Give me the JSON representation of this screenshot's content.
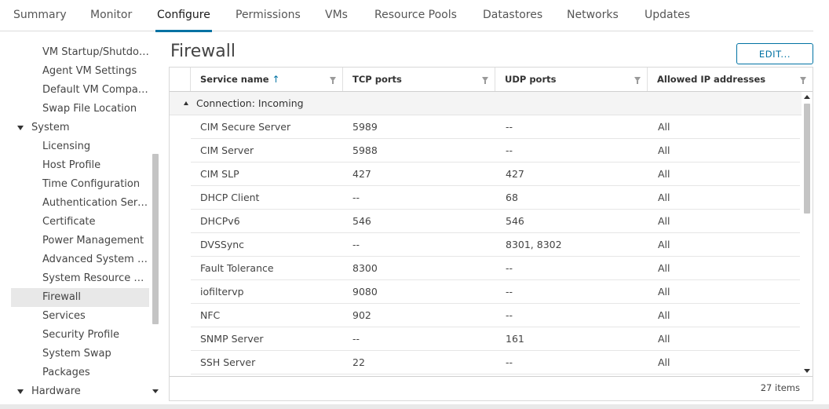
{
  "tabs": [
    "Summary",
    "Monitor",
    "Configure",
    "Permissions",
    "VMs",
    "Resource Pools",
    "Datastores",
    "Networks",
    "Updates"
  ],
  "active_tab": "Configure",
  "nav": {
    "items": [
      {
        "label": "VM Startup/Shutdown"
      },
      {
        "label": "Agent VM Settings"
      },
      {
        "label": "Default VM Compatibility"
      },
      {
        "label": "Swap File Location"
      },
      {
        "label": "System"
      },
      {
        "label": "Licensing"
      },
      {
        "label": "Host Profile"
      },
      {
        "label": "Time Configuration"
      },
      {
        "label": "Authentication Services"
      },
      {
        "label": "Certificate"
      },
      {
        "label": "Power Management"
      },
      {
        "label": "Advanced System Settings"
      },
      {
        "label": "System Resource Reservation"
      },
      {
        "label": "Firewall"
      },
      {
        "label": "Services"
      },
      {
        "label": "Security Profile"
      },
      {
        "label": "System Swap"
      },
      {
        "label": "Packages"
      },
      {
        "label": "Hardware"
      }
    ]
  },
  "panel": {
    "title": "Firewall",
    "edit_label": "EDIT..."
  },
  "grid": {
    "columns": [
      "Service name",
      "TCP ports",
      "UDP ports",
      "Allowed IP addresses"
    ],
    "sort_indicator": "↑",
    "group_label": "Connection: Incoming",
    "rows": [
      {
        "service": "CIM Secure Server",
        "tcp": "5989",
        "udp": "--",
        "allowed": "All"
      },
      {
        "service": "CIM Server",
        "tcp": "5988",
        "udp": "--",
        "allowed": "All"
      },
      {
        "service": "CIM SLP",
        "tcp": "427",
        "udp": "427",
        "allowed": "All"
      },
      {
        "service": "DHCP Client",
        "tcp": "--",
        "udp": "68",
        "allowed": "All"
      },
      {
        "service": "DHCPv6",
        "tcp": "546",
        "udp": "546",
        "allowed": "All"
      },
      {
        "service": "DVSSync",
        "tcp": "--",
        "udp": "8301, 8302",
        "allowed": "All"
      },
      {
        "service": "Fault Tolerance",
        "tcp": "8300",
        "udp": "--",
        "allowed": "All"
      },
      {
        "service": "iofiltervp",
        "tcp": "9080",
        "udp": "--",
        "allowed": "All"
      },
      {
        "service": "NFC",
        "tcp": "902",
        "udp": "--",
        "allowed": "All"
      },
      {
        "service": "SNMP Server",
        "tcp": "--",
        "udp": "161",
        "allowed": "All"
      },
      {
        "service": "SSH Server",
        "tcp": "22",
        "udp": "--",
        "allowed": "All"
      }
    ],
    "footer": "27 items"
  },
  "colors": {
    "accent": "#0072a3",
    "selected_bg": "#e8e8e8"
  }
}
